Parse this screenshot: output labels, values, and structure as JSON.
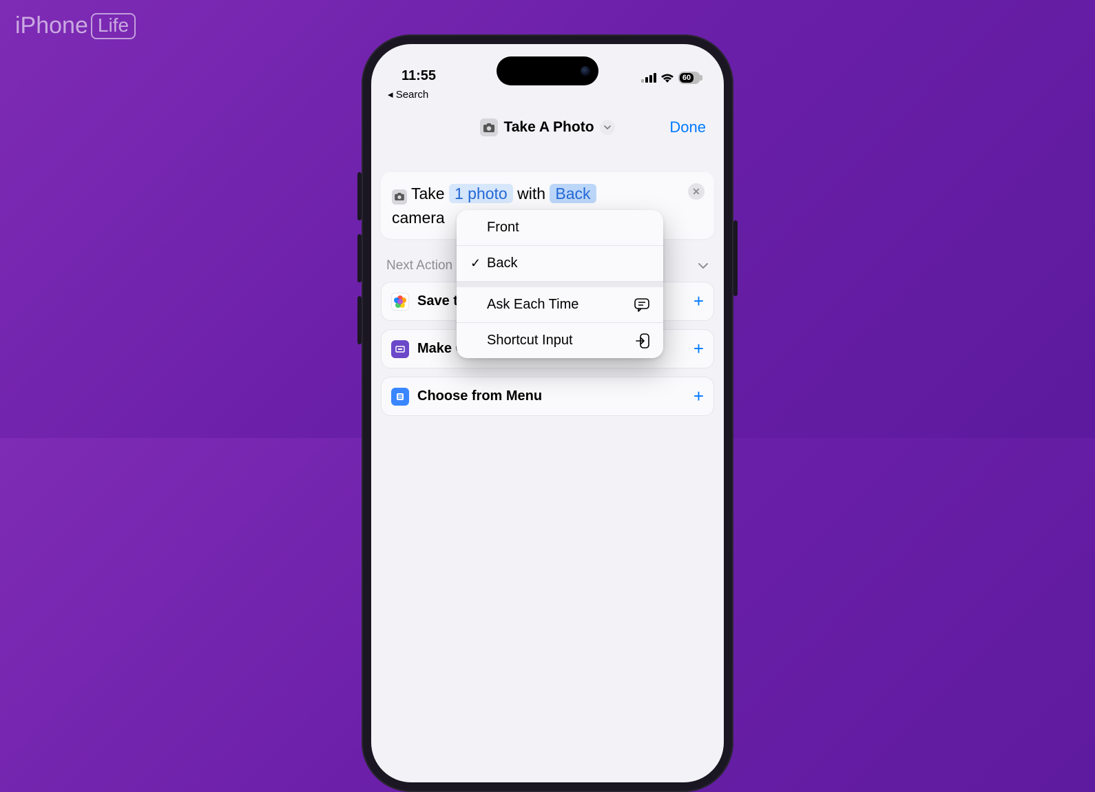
{
  "watermark": {
    "brand": "iPhone",
    "suffix": "Life"
  },
  "status": {
    "time": "11:55",
    "battery": "60",
    "back": "◂ Search"
  },
  "header": {
    "title": "Take A Photo",
    "done": "Done"
  },
  "action": {
    "w1": "Take",
    "count": "1 photo",
    "w2": "with",
    "camera": "Back",
    "w3": "camera"
  },
  "section": {
    "label": "Next Action Suggestions"
  },
  "suggestions": [
    {
      "label": "Save to Photo Album"
    },
    {
      "label": "Make GIF"
    },
    {
      "label": "Choose from Menu"
    }
  ],
  "popup": {
    "front": "Front",
    "back": "Back",
    "ask": "Ask Each Time",
    "input": "Shortcut Input"
  }
}
